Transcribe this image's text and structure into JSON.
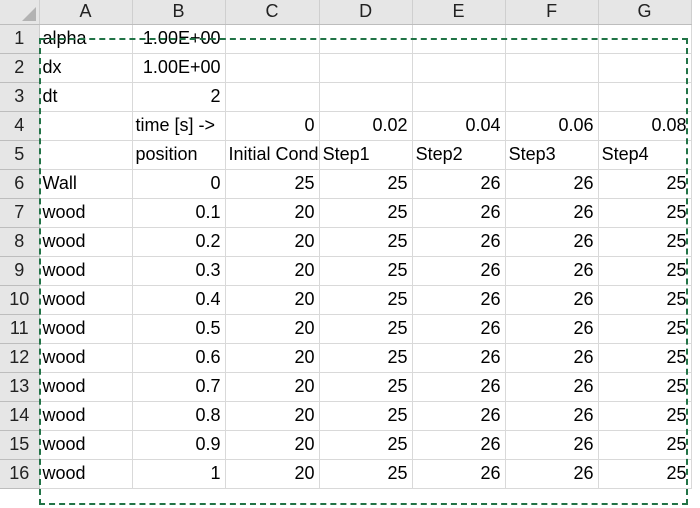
{
  "columns": [
    "A",
    "B",
    "C",
    "D",
    "E",
    "F",
    "G"
  ],
  "rows": [
    {
      "num": "1",
      "A": "alpha",
      "B": "1.00E+00",
      "C": "",
      "D": "",
      "E": "",
      "F": "",
      "G": ""
    },
    {
      "num": "2",
      "A": "dx",
      "B": "1.00E+00",
      "C": "",
      "D": "",
      "E": "",
      "F": "",
      "G": ""
    },
    {
      "num": "3",
      "A": "dt",
      "B": "2",
      "C": "",
      "D": "",
      "E": "",
      "F": "",
      "G": ""
    },
    {
      "num": "4",
      "A": "",
      "B": "time [s] ->",
      "C": "0",
      "D": "0.02",
      "E": "0.04",
      "F": "0.06",
      "G": "0.08"
    },
    {
      "num": "5",
      "A": "",
      "B": "position",
      "C": "Initial Cond",
      "D": "Step1",
      "E": "Step2",
      "F": "Step3",
      "G": "Step4"
    },
    {
      "num": "6",
      "A": "Wall",
      "B": "0",
      "C": "25",
      "D": "25",
      "E": "26",
      "F": "26",
      "G": "25"
    },
    {
      "num": "7",
      "A": "wood",
      "B": "0.1",
      "C": "20",
      "D": "25",
      "E": "26",
      "F": "26",
      "G": "25"
    },
    {
      "num": "8",
      "A": "wood",
      "B": "0.2",
      "C": "20",
      "D": "25",
      "E": "26",
      "F": "26",
      "G": "25"
    },
    {
      "num": "9",
      "A": "wood",
      "B": "0.3",
      "C": "20",
      "D": "25",
      "E": "26",
      "F": "26",
      "G": "25"
    },
    {
      "num": "10",
      "A": "wood",
      "B": "0.4",
      "C": "20",
      "D": "25",
      "E": "26",
      "F": "26",
      "G": "25"
    },
    {
      "num": "11",
      "A": "wood",
      "B": "0.5",
      "C": "20",
      "D": "25",
      "E": "26",
      "F": "26",
      "G": "25"
    },
    {
      "num": "12",
      "A": "wood",
      "B": "0.6",
      "C": "20",
      "D": "25",
      "E": "26",
      "F": "26",
      "G": "25"
    },
    {
      "num": "13",
      "A": "wood",
      "B": "0.7",
      "C": "20",
      "D": "25",
      "E": "26",
      "F": "26",
      "G": "25"
    },
    {
      "num": "14",
      "A": "wood",
      "B": "0.8",
      "C": "20",
      "D": "25",
      "E": "26",
      "F": "26",
      "G": "25"
    },
    {
      "num": "15",
      "A": "wood",
      "B": "0.9",
      "C": "20",
      "D": "25",
      "E": "26",
      "F": "26",
      "G": "25"
    },
    {
      "num": "16",
      "A": "wood",
      "B": "1",
      "C": "20",
      "D": "25",
      "E": "26",
      "F": "26",
      "G": "25"
    }
  ],
  "colors": {
    "selection_border": "#217346",
    "header_bg": "#e6e6e6",
    "gridline": "#d9d9d9"
  }
}
